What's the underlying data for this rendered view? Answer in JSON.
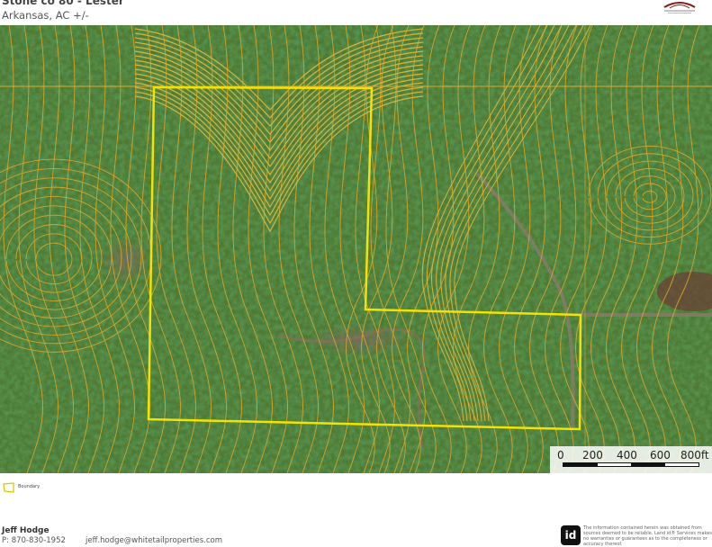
{
  "header": {
    "title": "Stone co 80 - Lester",
    "subtitle": "Arkansas,  AC +/-"
  },
  "logo": {
    "name": "whitetail-properties-logo"
  },
  "map": {
    "type": "topographic-aerial",
    "boundary_color": "#f2e300",
    "contour_color": "#e0a92a",
    "scale_bar": {
      "labels": [
        "0",
        "200",
        "400",
        "600",
        "800ft"
      ]
    }
  },
  "legend": {
    "items": [
      {
        "label": "Boundary",
        "color": "#f2e300"
      }
    ]
  },
  "footer": {
    "name": "Jeff Hodge",
    "phone": "P: 870-830-1952",
    "email": "jeff.hodge@whitetailproperties.com",
    "id_logo": "id",
    "disclaimer": "The information contained herein was obtained from sources deemed to be reliable. Land id® Services makes no warranties or guarantees as to the completeness or accuracy thereof."
  }
}
